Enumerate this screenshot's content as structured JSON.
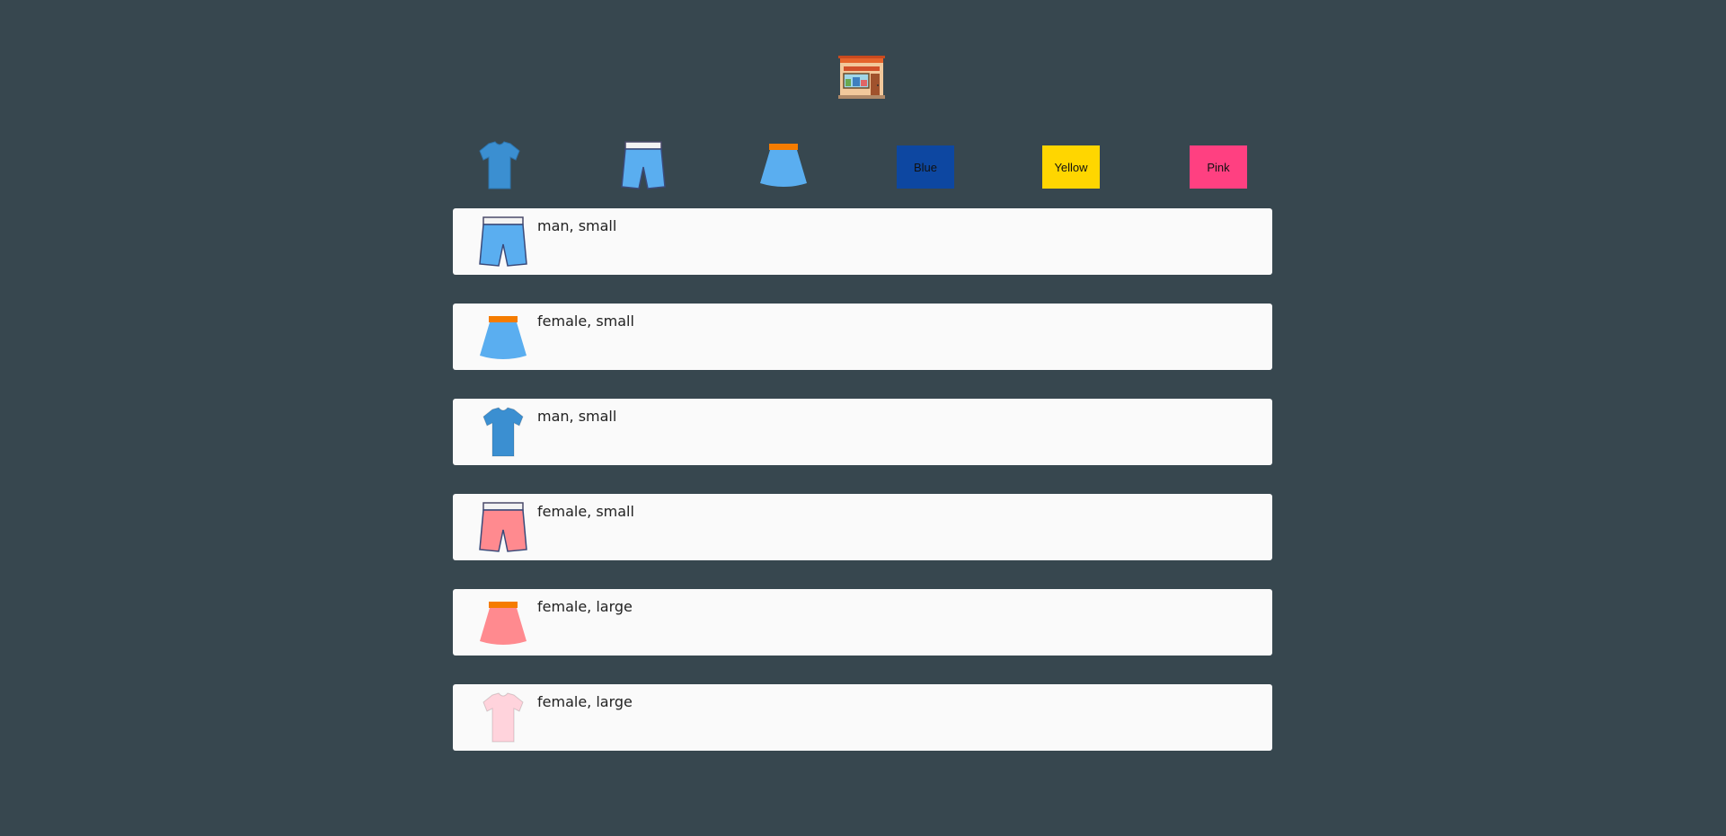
{
  "store": {
    "logo_icon": "store-icon"
  },
  "filters": {
    "categories": [
      {
        "name": "tshirt",
        "icon": "tshirt-icon"
      },
      {
        "name": "shorts",
        "icon": "shorts-icon"
      },
      {
        "name": "skirt",
        "icon": "skirt-icon"
      }
    ],
    "colors": [
      {
        "label": "Blue",
        "color": "#0d47a1"
      },
      {
        "label": "Yellow",
        "color": "#ffd600"
      },
      {
        "label": "Pink",
        "color": "#ff4081"
      }
    ]
  },
  "products": [
    {
      "type": "shorts",
      "icon": "shorts-icon",
      "color": "#5aaef0",
      "label": "man, small"
    },
    {
      "type": "skirt",
      "icon": "skirt-icon",
      "color": "#5aaef0",
      "label": "female, small"
    },
    {
      "type": "tshirt",
      "icon": "tshirt-icon",
      "color": "#3b8fd1",
      "label": "man, small"
    },
    {
      "type": "shorts",
      "icon": "shorts-icon",
      "color": "#ff8a8f",
      "label": "female, small"
    },
    {
      "type": "skirt",
      "icon": "skirt-icon",
      "color": "#ff8a8f",
      "label": "female, large"
    },
    {
      "type": "tshirt",
      "icon": "tshirt-icon",
      "color": "#ffd3dc",
      "label": "female, large"
    }
  ]
}
